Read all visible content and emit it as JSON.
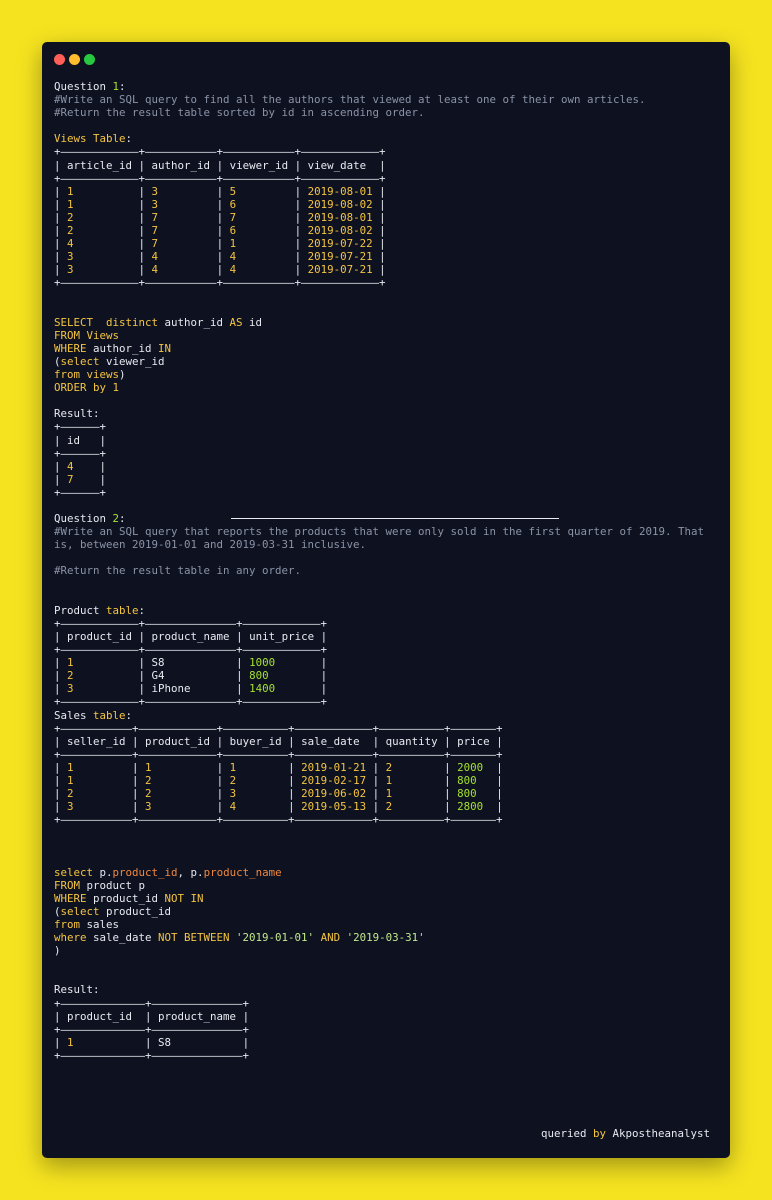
{
  "window": {
    "controls": [
      "close",
      "minimize",
      "zoom"
    ]
  },
  "footer": {
    "prefix": "queried ",
    "by": "by",
    "author": " Akpostheanalyst"
  },
  "q1": {
    "title_label": "Question ",
    "title_num": "1",
    "title_colon": ":",
    "comment1": "#Write an SQL query to find all the authors that viewed at least one of their own articles.",
    "comment2": "#Return the result table sorted by id in ascending order.",
    "table_name": "Views Table",
    "table_colon": ":",
    "views_border": "+————————————+——————————+——————————+——————————+",
    "views_header": [
      "article_id",
      "author_id",
      "viewer_id",
      "view_date"
    ],
    "views_rows": [
      [
        "1",
        "3",
        "5",
        "2019-08-01"
      ],
      [
        "1",
        "3",
        "6",
        "2019-08-02"
      ],
      [
        "2",
        "7",
        "7",
        "2019-08-01"
      ],
      [
        "2",
        "7",
        "6",
        "2019-08-02"
      ],
      [
        "4",
        "7",
        "1",
        "2019-07-22"
      ],
      [
        "3",
        "4",
        "4",
        "2019-07-21"
      ],
      [
        "3",
        "4",
        "4",
        "2019-07-21"
      ]
    ],
    "sql": {
      "l1_kw": "SELECT  distinct",
      "l1_rest": " author_id ",
      "l1_as": "AS",
      "l1_id": " id",
      "l2_kw": "FROM Views",
      "l3_kw": "WHERE",
      "l3_rest": " author_id ",
      "l3_in": "IN",
      "l4_paren": "(",
      "l4_kw": "select",
      "l4_rest": " viewer_id",
      "l5_kw": "from views",
      "l5_paren": ")",
      "l6_kw": "ORDER by 1"
    },
    "result_label": "Result:",
    "result_header": "id",
    "result_rows": [
      "4",
      "7"
    ]
  },
  "q2": {
    "title_label": "Question ",
    "title_num": "2",
    "title_colon": ":",
    "comment1": "#Write an SQL query that reports the products that were only sold in the first quarter of 2019. That",
    "comment2": "is, between 2019-01-01 and 2019-03-31 inclusive.",
    "comment3": "#Return the result table in any order.",
    "product_label": "Product ",
    "product_kw": "table",
    "product_colon": ":",
    "product_header": [
      "product_id",
      "product_name",
      "unit_price"
    ],
    "product_rows": [
      [
        "1",
        "S8",
        "1000"
      ],
      [
        "2",
        "G4",
        "800"
      ],
      [
        "3",
        "iPhone",
        "1400"
      ]
    ],
    "sales_label": "Sales ",
    "sales_kw": "table",
    "sales_colon": ":",
    "sales_header": [
      "seller_id",
      "product_id",
      "buyer_id",
      "sale_date",
      "quantity",
      "price"
    ],
    "sales_rows": [
      [
        "1",
        "1",
        "1",
        "2019-01-21",
        "2",
        "2000"
      ],
      [
        "1",
        "2",
        "2",
        "2019-02-17",
        "1",
        "800"
      ],
      [
        "2",
        "2",
        "3",
        "2019-06-02",
        "1",
        "800"
      ],
      [
        "3",
        "3",
        "4",
        "2019-05-13",
        "2",
        "2800"
      ]
    ],
    "sql": {
      "l1_kw": "select",
      "l1_a": " p.",
      "l1_f1": "product_id",
      "l1_b": ", p.",
      "l1_f2": "product_name",
      "l2_kw": "FROM",
      "l2_rest": " product p",
      "l3_kw": "WHERE",
      "l3_rest": " product_id ",
      "l3_not": "NOT IN",
      "l4_paren": "(",
      "l4_kw": "select",
      "l4_rest": " product_id",
      "l5_kw": "from",
      "l5_rest": " sales",
      "l6_kw": "where",
      "l6_rest": " sale_date ",
      "l6_nb": "NOT BETWEEN",
      "l6_s1": " '2019-01-01' ",
      "l6_and": "AND",
      "l6_s2": " '2019-03-31'",
      "l7_paren": ")"
    },
    "result_label": "Result:",
    "result_header": [
      "product_id",
      "product_name"
    ],
    "result_rows": [
      [
        "1",
        "S8"
      ]
    ]
  }
}
